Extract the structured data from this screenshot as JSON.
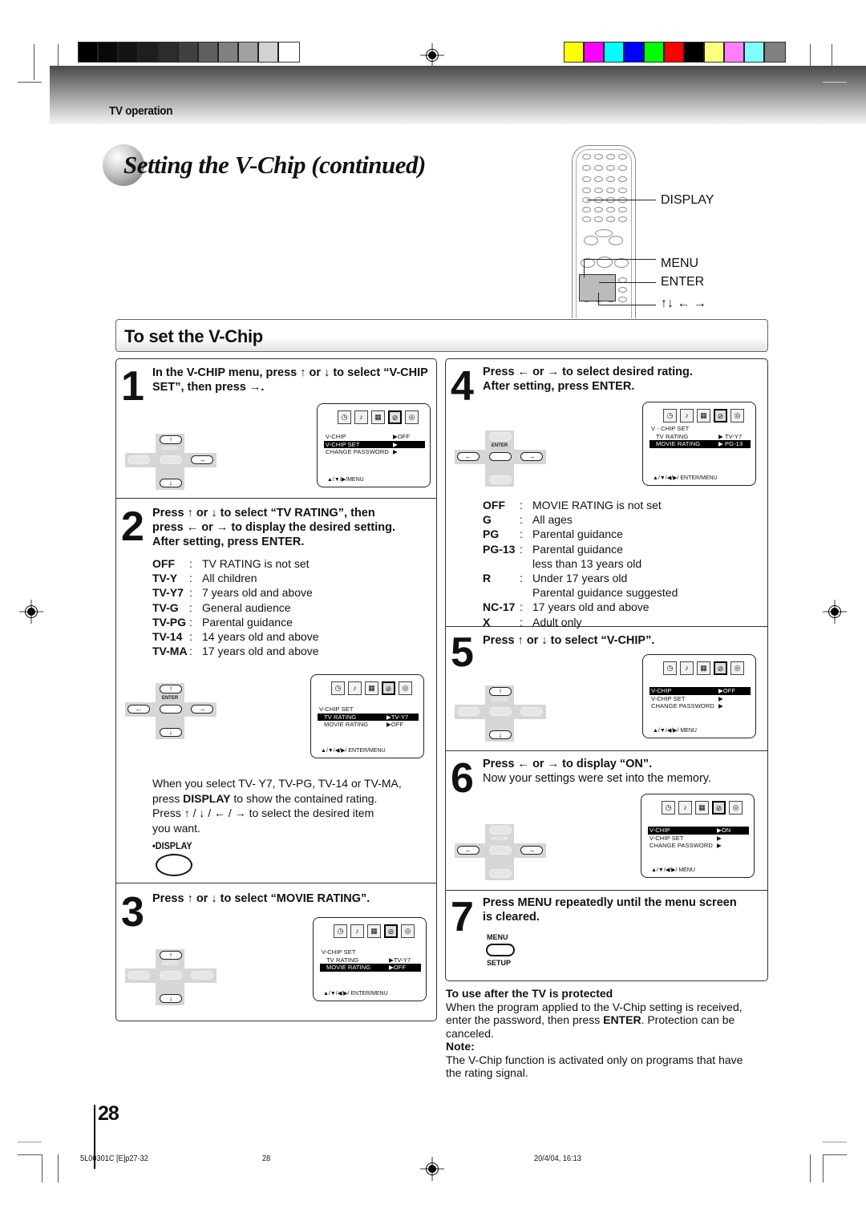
{
  "print_marks": {
    "grayscale_swatches": [
      "#000000",
      "#0a0a0a",
      "#141414",
      "#1e1e1e",
      "#2d2d2d",
      "#414141",
      "#5f5f5f",
      "#808080",
      "#a0a0a0",
      "#d2d2d2",
      "#ffffff"
    ],
    "color_swatches": [
      "#ffff00",
      "#ff00ff",
      "#00ffff",
      "#0000ff",
      "#00ff00",
      "#ff0000",
      "#000000",
      "#ffff80",
      "#ff80ff",
      "#80ffff",
      "#808080"
    ]
  },
  "header": {
    "section": "TV operation",
    "title": "Setting the V-Chip (continued)"
  },
  "remote": {
    "labels": {
      "display": "DISPLAY",
      "menu": "MENU",
      "enter": "ENTER",
      "arrows": "↑↓ ← →"
    }
  },
  "section_title": "To set the V-Chip",
  "dpad": {
    "enter_label": "ENTER"
  },
  "osd": {
    "icons": [
      "clock-icon",
      "music-icon",
      "grid-icon",
      "lock-icon",
      "tape-icon"
    ]
  },
  "steps": [
    {
      "number": "1",
      "text_a": "In the V-CHIP menu, press ",
      "text_b": " or ",
      "text_c": " to select  “V-CHIP SET”, then press ",
      "text_d": ".",
      "osd": {
        "rows": [
          {
            "label": "V-CHIP",
            "value": "▶OFF",
            "highlight": false
          },
          {
            "label": "V-CHIP SET",
            "value": "▶",
            "highlight": true
          },
          {
            "label": "CHANGE PASSWORD",
            "value": "▶",
            "highlight": false
          }
        ],
        "footer": "▲/▼/▶/MENU"
      }
    },
    {
      "number": "2",
      "line1_a": "Press ",
      "line1_b": " or ",
      "line1_c": " to select “TV RATING”, then",
      "line2_a": "press ",
      "line2_b": " or ",
      "line2_c": " to display the desired setting.",
      "line3": "After setting, press ENTER.",
      "ratings": [
        {
          "code": "OFF",
          "desc": "TV RATING is not set"
        },
        {
          "code": "TV-Y",
          "desc": "All children"
        },
        {
          "code": "TV-Y7",
          "desc": "7 years old and above"
        },
        {
          "code": "TV-G",
          "desc": "General audience"
        },
        {
          "code": "TV-PG",
          "desc": "Parental guidance"
        },
        {
          "code": "TV-14",
          "desc": "14 years old and above"
        },
        {
          "code": "TV-MA",
          "desc": "17 years old and above"
        }
      ],
      "osd": {
        "header": "V-CHIP SET",
        "rows": [
          {
            "label": "TV RATING",
            "value": "▶TV-Y7",
            "highlight": true
          },
          {
            "label": "MOVIE RATING",
            "value": "▶OFF",
            "highlight": false
          }
        ],
        "footer": "▲/▼/◀/▶/ ENTER/MENU"
      },
      "note_l1": "When you select TV- Y7, TV-PG, TV-14 or TV-MA,",
      "note_l2_a": "press ",
      "note_l2_b": "DISPLAY",
      "note_l2_c": " to show the contained rating.",
      "note_l3_a": "Press ",
      "note_l3_b": " to select the desired item",
      "note_l4": "you want.",
      "display_button_label": "•DISPLAY"
    },
    {
      "number": "3",
      "text_a": "Press ",
      "text_b": " or ",
      "text_c": " to select “MOVIE RATING”.",
      "osd": {
        "header": "V-CHIP SET",
        "rows": [
          {
            "label": "TV RATING",
            "value": "▶TV-Y7",
            "highlight": false
          },
          {
            "label": "MOVIE RATING",
            "value": "▶OFF",
            "highlight": true
          }
        ],
        "footer": "▲/▼/◀/▶/ ENTER/MENU"
      }
    },
    {
      "number": "4",
      "line1_a": "Press ",
      "line1_b": " or ",
      "line1_c": " to select desired rating.",
      "line2": "After setting, press ENTER.",
      "osd": {
        "header": "V - CHIP  SET",
        "rows": [
          {
            "label": "TV  RATING",
            "value": "▶ TV-Y7",
            "highlight": false
          },
          {
            "label": "MOVIE  RATING",
            "value": "▶ PG-13",
            "highlight": true
          }
        ],
        "footer": "▲/▼/◀/▶/ ENTER/MENU"
      },
      "ratings": [
        {
          "code": "OFF",
          "desc": "MOVIE RATING is not set"
        },
        {
          "code": "G",
          "desc": "All ages"
        },
        {
          "code": "PG",
          "desc": "Parental guidance"
        },
        {
          "code": "PG-13",
          "desc": "Parental guidance"
        },
        {
          "code": "",
          "desc": "less than 13 years old",
          "continuation": true
        },
        {
          "code": "R",
          "desc": "Under 17 years old"
        },
        {
          "code": "",
          "desc": "Parental guidance suggested",
          "continuation": true
        },
        {
          "code": "NC-17",
          "desc": "17 years old and above"
        },
        {
          "code": "X",
          "desc": "Adult only"
        }
      ]
    },
    {
      "number": "5",
      "text_a": "Press ",
      "text_b": " or ",
      "text_c": " to select “V-CHIP”.",
      "osd": {
        "rows": [
          {
            "label": "V-CHIP",
            "value": "▶OFF",
            "highlight": true
          },
          {
            "label": "V-CHIP  SET",
            "value": "▶",
            "highlight": false
          },
          {
            "label": "CHANGE  PASSWORD",
            "value": "▶",
            "highlight": false
          }
        ],
        "footer": "▲/▼/◀/▶/ MENU"
      }
    },
    {
      "number": "6",
      "line1_a": "Press ",
      "line1_b": " or ",
      "line1_c": " to display “ON”.",
      "line2": "Now your settings were set into the memory.",
      "osd": {
        "rows": [
          {
            "label": "V-CHIP",
            "value": "▶ON",
            "highlight": true
          },
          {
            "label": "V-CHIP  SET",
            "value": "▶",
            "highlight": false
          },
          {
            "label": "CHANGE  PASSWORD",
            "value": "▶",
            "highlight": false
          }
        ],
        "footer": "▲/▼/◀/▶/ MENU"
      }
    },
    {
      "number": "7",
      "line1": "Press MENU repeatedly until the menu screen",
      "line2": "is cleared.",
      "button_top_label": "MENU",
      "button_bottom_label": "SETUP"
    }
  ],
  "protected": {
    "heading": "To use after the TV is protected",
    "l1": "When the program applied to the V-Chip setting is received,",
    "l2_a": "enter the password, then press ",
    "l2_b": "ENTER",
    "l2_c": ". Protection can be",
    "l3": "canceled.",
    "note_heading": "Note:",
    "note_l1": "The V-Chip function is activated only on programs that have",
    "note_l2": "the rating signal."
  },
  "glyphs": {
    "up": "↑",
    "down": "↓",
    "left": "←",
    "right": "→",
    "slash": " / "
  },
  "page_number": "28",
  "footer": {
    "file": "5L00301C [E]p27-32",
    "page": "28",
    "timestamp": "20/4/04, 16:13"
  }
}
